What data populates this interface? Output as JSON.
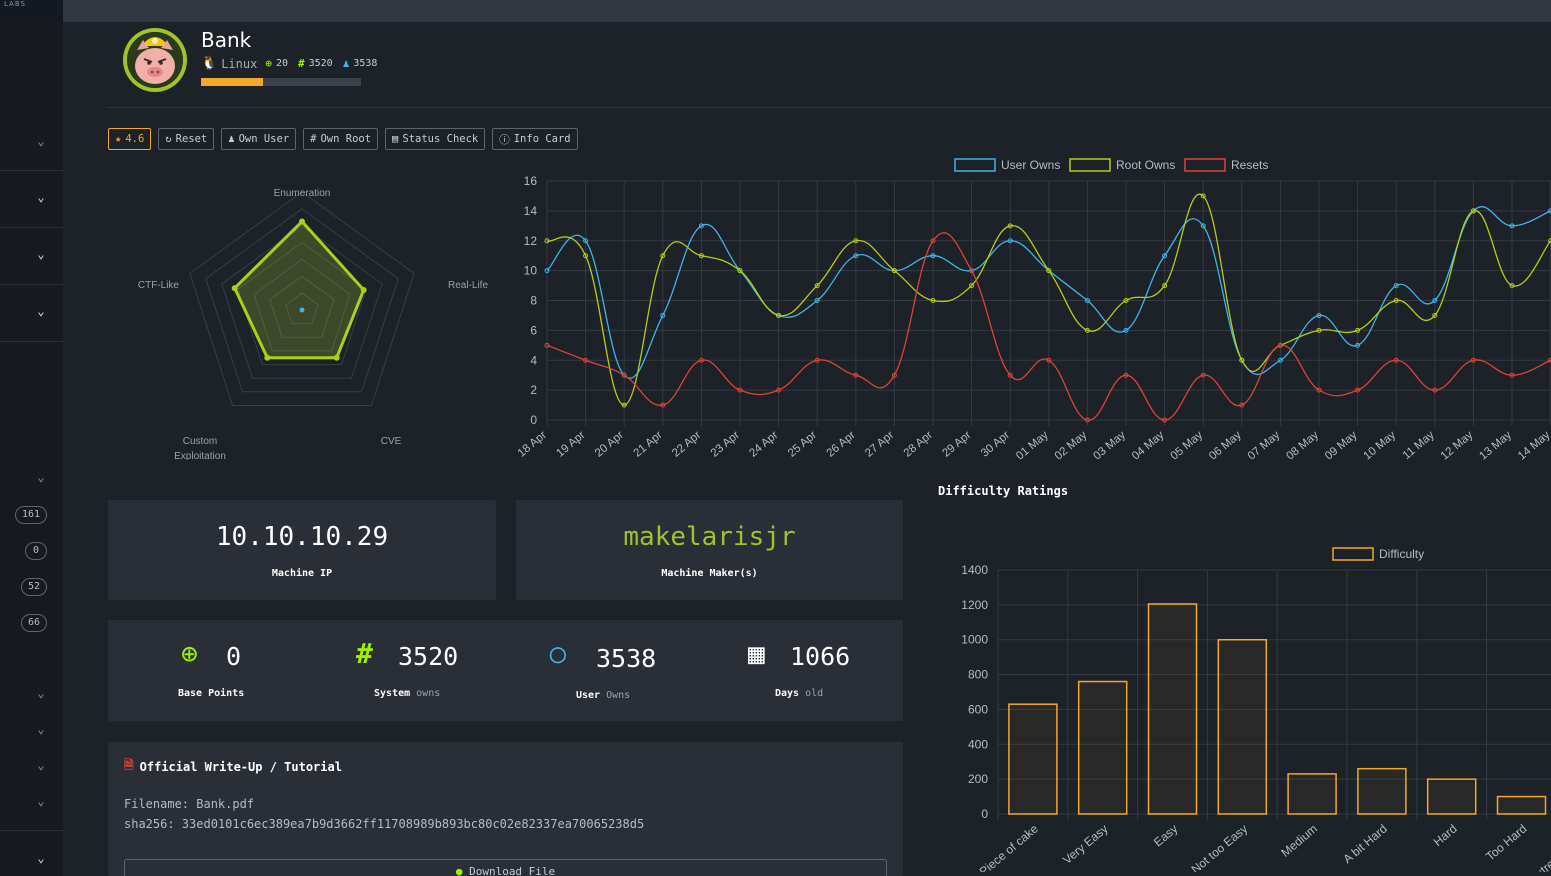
{
  "app": {
    "logo_text": "LABS"
  },
  "sidebar": {
    "badges": [
      "161",
      "0",
      "52",
      "66"
    ]
  },
  "machine": {
    "name": "Bank",
    "os": "Linux",
    "points": "20",
    "system_owns": "3520",
    "user_owns": "3538",
    "difficulty_progress": 0.39
  },
  "toolbar": {
    "rating": "4.6",
    "reset": "Reset",
    "own_user": "Own User",
    "own_root": "Own Root",
    "status_check": "Status Check",
    "info_card": "Info Card"
  },
  "info": {
    "ip": "10.10.10.29",
    "ip_label": "Machine IP",
    "maker": "makelarisjr",
    "maker_label": "Machine Maker(s)"
  },
  "stats": {
    "base_points": "0",
    "base_points_label": "Base Points",
    "system": "3520",
    "system_label": "System",
    "system_suffix": "owns",
    "user": "3538",
    "user_label": "User",
    "user_suffix": "Owns",
    "days": "1066",
    "days_label": "Days",
    "days_suffix": "old"
  },
  "writeup": {
    "title": "Official Write-Up / Tutorial",
    "filename_line": "Filename: Bank.pdf",
    "sha_line": "sha256: 33ed0101c6ec389ea7b9d3662ff11708989b893bc80c02e82337ea70065238d5",
    "download": "Download File"
  },
  "difficulty_title": "Difficulty Ratings",
  "colors": {
    "accent_green": "#9fef00",
    "user_blue": "#3fb4e5",
    "root_yellow": "#b5cc18",
    "reset_red": "#db4437",
    "bar_orange": "#f2a82b"
  },
  "chart_data": [
    {
      "type": "radar",
      "categories": [
        "Enumeration",
        "Real-Life",
        "CVE",
        "Custom Exploitation",
        "CTF-Like"
      ],
      "values": [
        0.75,
        0.55,
        0.5,
        0.5,
        0.6
      ]
    },
    {
      "type": "line",
      "x": [
        "18 Apr",
        "19 Apr",
        "20 Apr",
        "21 Apr",
        "22 Apr",
        "23 Apr",
        "24 Apr",
        "25 Apr",
        "26 Apr",
        "27 Apr",
        "28 Apr",
        "29 Apr",
        "30 Apr",
        "01 May",
        "02 May",
        "03 May",
        "04 May",
        "05 May",
        "06 May",
        "07 May",
        "08 May",
        "09 May",
        "10 May",
        "11 May",
        "12 May",
        "13 May",
        "14 May"
      ],
      "series": [
        {
          "name": "User Owns",
          "values": [
            10,
            12,
            3,
            7,
            13,
            10,
            7,
            8,
            11,
            10,
            11,
            10,
            12,
            10,
            8,
            6,
            11,
            13,
            4,
            4,
            7,
            5,
            9,
            8,
            14,
            13,
            14
          ]
        },
        {
          "name": "Root Owns",
          "values": [
            12,
            11,
            1,
            11,
            11,
            10,
            7,
            9,
            12,
            10,
            8,
            9,
            13,
            10,
            6,
            8,
            9,
            15,
            4,
            5,
            6,
            6,
            8,
            7,
            14,
            9,
            12
          ]
        },
        {
          "name": "Resets",
          "values": [
            5,
            4,
            3,
            1,
            4,
            2,
            2,
            4,
            3,
            3,
            12,
            10,
            3,
            4,
            0,
            3,
            0,
            3,
            1,
            5,
            2,
            2,
            4,
            2,
            4,
            3,
            4
          ]
        }
      ],
      "ylim": [
        0,
        16
      ],
      "yticks": [
        0,
        2,
        4,
        6,
        8,
        10,
        12,
        14,
        16
      ],
      "grid": true,
      "legend": "top"
    },
    {
      "type": "bar",
      "title": "Difficulty Ratings",
      "categories": [
        "Piece of cake",
        "Very Easy",
        "Easy",
        "Not too Easy",
        "Medium",
        "A bit Hard",
        "Hard",
        "Too Hard",
        "Extremely Hard"
      ],
      "series": [
        {
          "name": "Difficulty",
          "values": [
            630,
            760,
            1205,
            1000,
            230,
            260,
            200,
            100,
            0
          ]
        }
      ],
      "ylim": [
        0,
        1400
      ],
      "yticks": [
        0,
        200,
        400,
        600,
        800,
        1000,
        1200,
        1400
      ],
      "grid": true,
      "legend": "top"
    }
  ]
}
